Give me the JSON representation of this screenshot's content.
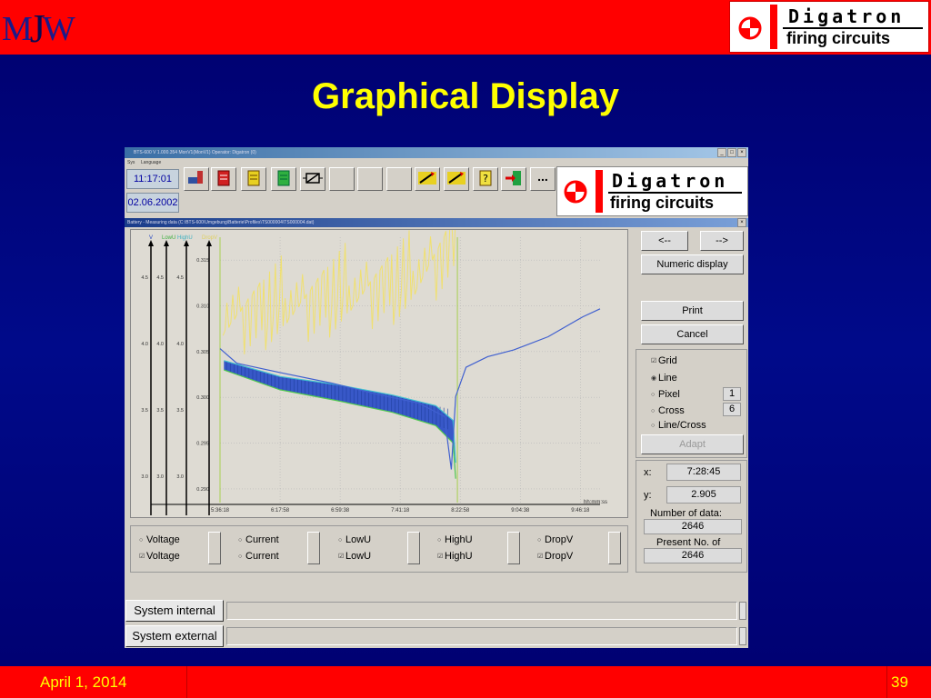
{
  "slide": {
    "logo_left": {
      "m": "M",
      "j": "J",
      "w": "W"
    },
    "logo_right": {
      "line1": "Digatron",
      "line2": "firing circuits"
    },
    "title": "Graphical Display",
    "footer_date": "April 1, 2014",
    "page_number": "39",
    "colors": {
      "bar": "#ff0000",
      "background": "#000a8a",
      "title": "#ffff00"
    }
  },
  "app": {
    "window_title": "BTS-600  V 1.000.354 MonV1(MonV1)   Operator: Digatron (0)",
    "menu": [
      "Sys",
      "Language"
    ],
    "clock": "11:17:01",
    "date": "02.06.2002",
    "toolbar_icons": [
      "network-icon",
      "red-device-icon",
      "yellow-device-icon",
      "green-device-icon",
      "relay-icon",
      "blank-button",
      "blank-button",
      "blank-button",
      "transfer-icon",
      "transfer-icon",
      "help-icon",
      "exit-icon",
      "more-icon"
    ],
    "more_label": "...",
    "logo": {
      "line1": "Digatron",
      "line2": "firing circuits"
    },
    "subwindow_title": "Battery - Measuring data (C:\\BTS-600\\Umgebung\\Batterie\\Profiles\\TS000004\\TS000004.dat)",
    "side": {
      "prev_label": "<--",
      "next_label": "-->",
      "numeric_label": "Numeric display",
      "print_label": "Print",
      "cancel_label": "Cancel",
      "grid_label": "Grid",
      "grid_checked": true,
      "line_label": "Line",
      "pixel_label": "Pixel",
      "cross_label": "Cross",
      "linecross_label": "Line/Cross",
      "selected_style": "Line",
      "pixel_value": "1",
      "cross_value": "6",
      "adapt_label": "Adapt",
      "x_label": "x:",
      "x_value": "7:28:45",
      "y_label": "y:",
      "y_value": "2.905",
      "numdata_label": "Number of data:",
      "numdata_value": "2646",
      "present_label": "Present No. of",
      "present_value": "2646"
    },
    "series_rows": [
      [
        "Voltage",
        "Current",
        "LowU",
        "HighU",
        "DropV"
      ],
      [
        "Voltage",
        "Current",
        "LowU",
        "HighU",
        "DropV"
      ]
    ],
    "series_checked_row2": [
      true,
      false,
      true,
      true,
      true
    ],
    "system_internal_label": "System internal",
    "system_external_label": "System external"
  },
  "chart_data": {
    "type": "line",
    "x_ticks": [
      "5:36:18",
      "6:17:58",
      "6:59:38",
      "7:41:18",
      "8:22:58",
      "9:04:38",
      "9:46:18"
    ],
    "x_unit_label": "hh:mm:ss",
    "axis_labels": {
      "v": "V",
      "lowu": "LowU",
      "highu": "HighU",
      "dropv": "DropV"
    },
    "voltage_ticks": [
      "4.5",
      "4.0",
      "3.5",
      "3.0"
    ],
    "dropv_ticks": [
      "0.315",
      "0.310",
      "0.305",
      "0.300",
      "0.295",
      "0.290"
    ],
    "grid": true,
    "series": [
      {
        "name": "Voltage",
        "x_hours": [
          5.605,
          5.8,
          6.3,
          6.9,
          7.4,
          7.9,
          8.2,
          8.28,
          8.33,
          8.45,
          8.7,
          9.0,
          9.4,
          9.8,
          10.0
        ],
        "values": [
          3.96,
          3.85,
          3.78,
          3.7,
          3.62,
          3.55,
          3.45,
          3.05,
          3.6,
          3.82,
          3.9,
          3.95,
          4.05,
          4.2,
          4.26
        ]
      },
      {
        "name": "HighU",
        "values": [
          3.87,
          3.75,
          3.69,
          3.61,
          3.53,
          3.42
        ]
      },
      {
        "name": "LowU",
        "values": [
          3.8,
          3.65,
          3.57,
          3.48,
          3.38,
          3.25
        ]
      },
      {
        "name": "DropV",
        "values": [
          0.308,
          0.309,
          0.31,
          0.311,
          0.312,
          0.316
        ]
      }
    ]
  }
}
